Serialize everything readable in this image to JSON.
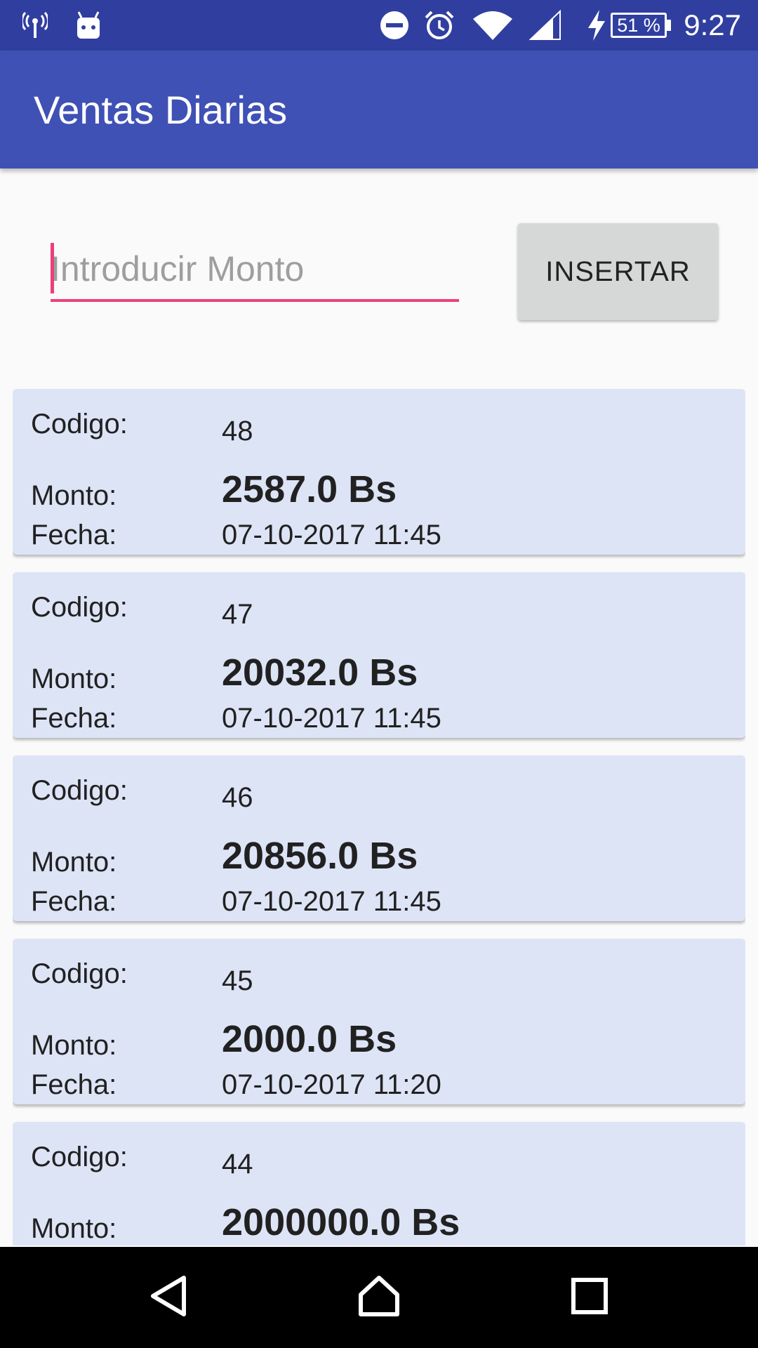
{
  "status_bar": {
    "time": "9:27",
    "battery_percent": "51 %",
    "icons": [
      "antenna-icon",
      "android-icon",
      "dnd-icon",
      "alarm-icon",
      "wifi-icon",
      "signal-icon",
      "charging-icon",
      "battery-icon"
    ]
  },
  "app_bar": {
    "title": "Ventas Diarias"
  },
  "form": {
    "monto_placeholder": "Introducir Monto",
    "monto_value": "",
    "insert_label": "INSERTAR"
  },
  "labels": {
    "codigo": "Codigo:",
    "monto": "Monto:",
    "fecha": "Fecha:"
  },
  "ventas": [
    {
      "codigo": "48",
      "monto": "2587.0 Bs",
      "fecha": "07-10-2017 11:45"
    },
    {
      "codigo": "47",
      "monto": "20032.0 Bs",
      "fecha": "07-10-2017 11:45"
    },
    {
      "codigo": "46",
      "monto": "20856.0 Bs",
      "fecha": "07-10-2017 11:45"
    },
    {
      "codigo": "45",
      "monto": "2000.0 Bs",
      "fecha": "07-10-2017 11:20"
    },
    {
      "codigo": "44",
      "monto": "2000000.0 Bs",
      "fecha": ""
    }
  ],
  "colors": {
    "status_bar": "#303f9f",
    "app_bar": "#3f51b5",
    "accent": "#ec407a",
    "card_bg": "#dde4f6"
  },
  "nav_bar": {
    "icons": [
      "back-icon",
      "home-icon",
      "recents-icon"
    ]
  }
}
